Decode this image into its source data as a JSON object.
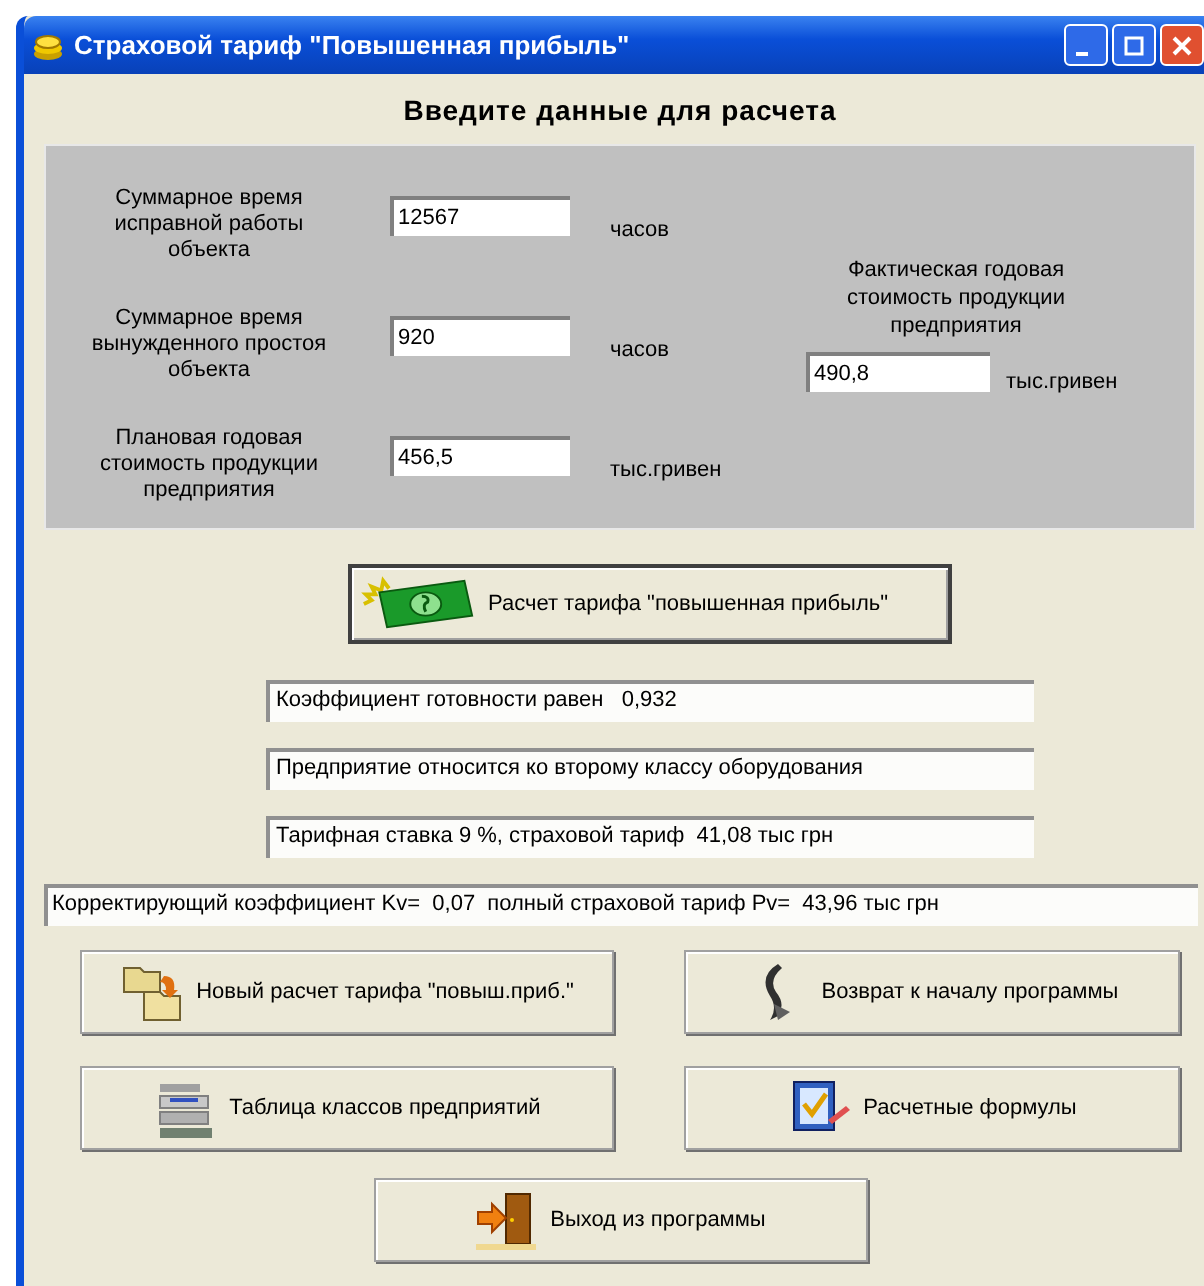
{
  "window": {
    "title": "Страховой тариф \"Повышенная прибыль\""
  },
  "heading": "Введите данные для расчета",
  "inputs": [
    {
      "label": "Суммарное время исправной работы объекта",
      "value": "12567",
      "unit": "часов"
    },
    {
      "label": "Суммарное время вынужденного простоя объекта",
      "value": "920",
      "unit": "часов"
    },
    {
      "label": "Плановая годовая стоимость продукции предприятия",
      "value": "456,5",
      "unit": "тыс.гривен"
    }
  ],
  "actual_cost": {
    "label": "Фактическая годовая стоимость продукции предприятия",
    "value": "490,8",
    "unit": "тыс.гривен"
  },
  "calc_button": "Расчет тарифа \"повышенная прибыль\"",
  "results": [
    "Коэффициент готовности равен   0,932",
    "Предприятие относится ко второму классу оборудования",
    "Тарифная ставка 9 %, страховой тариф  41,08 тыс грн"
  ],
  "summary": "Корректирующий коэффициент Kv=  0,07  полный страховой тариф Pv=  43,96 тыс грн",
  "buttons": [
    "Новый расчет тарифа \"повыш.приб.\"",
    "Возврат к началу программы",
    "Таблица классов предприятий",
    "Расчетные формулы"
  ],
  "exit_button": "Выход из программы"
}
